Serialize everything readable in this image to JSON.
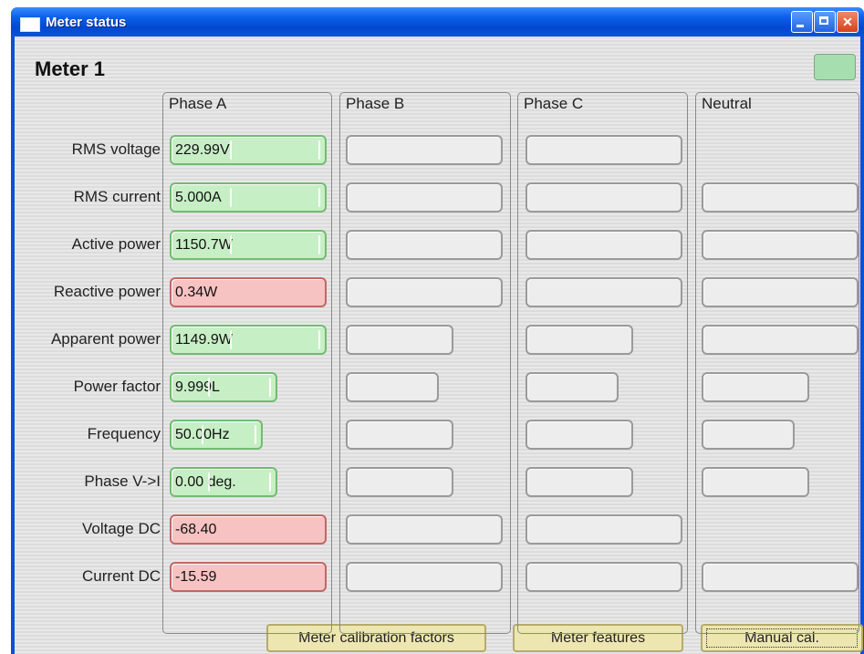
{
  "window": {
    "title": "Meter status"
  },
  "meter": {
    "name": "Meter 1"
  },
  "phases": [
    "Phase A",
    "Phase B",
    "Phase C",
    "Neutral"
  ],
  "rows": [
    "RMS voltage",
    "RMS current",
    "Active power",
    "Reactive power",
    "Apparent power",
    "Power factor",
    "Frequency",
    "Phase V->I",
    "Voltage DC",
    "Current DC"
  ],
  "phase_a_values": [
    "229.99V",
    "5.000A",
    "1150.7W",
    "0.34W",
    "1149.9W",
    "9.999L",
    "50.00Hz",
    "0.00 deg.",
    "-68.40",
    "-15.59"
  ],
  "phase_a_status": [
    "ok",
    "ok",
    "ok",
    "alert",
    "ok",
    "ok",
    "ok",
    "ok",
    "alert",
    "alert"
  ],
  "buttons": {
    "calibration": "Meter calibration factors",
    "features": "Meter features",
    "manual": "Manual cal."
  },
  "colors": {
    "ok": "#c7efc5",
    "alert": "#f7c2c2",
    "empty": "#ededed",
    "button": "#eee6b0",
    "titlebar": "#0a5ee8"
  }
}
